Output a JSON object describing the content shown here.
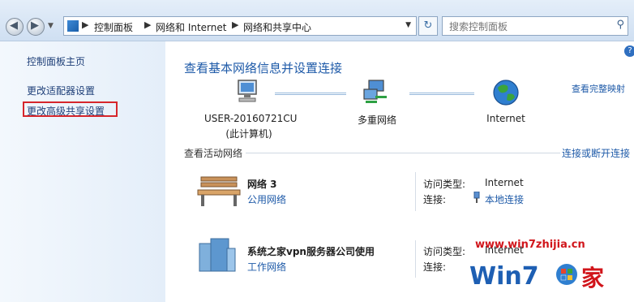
{
  "breadcrumb": [
    "控制面板",
    "网络和 Internet",
    "网络和共享中心"
  ],
  "search": {
    "placeholder": "搜索控制面板"
  },
  "sidebar": {
    "items": [
      "控制面板主页",
      "更改适配器设置",
      "更改高级共享设置"
    ]
  },
  "main": {
    "title": "查看基本网络信息并设置连接",
    "view_full_map": "查看完整映射",
    "map": {
      "computer_name": "USER-20160721CU",
      "computer_sub": "(此计算机)",
      "multi_network": "多重网络",
      "internet": "Internet"
    },
    "active_section": "查看活动网络",
    "connect_link": "连接或断开连接",
    "networks": [
      {
        "name": "网络  3",
        "type": "公用网络",
        "access_label": "访问类型:",
        "access_value": "Internet",
        "conn_label": "连接:",
        "conn_value": "本地连接"
      },
      {
        "name": "系统之家vpn服务器公司使用",
        "type": "工作网络",
        "access_label": "访问类型:",
        "access_value": "Internet",
        "conn_label": "连接:",
        "conn_value": ""
      }
    ]
  },
  "watermark": {
    "url": "www.win7zhijia.cn",
    "logo_text": "Win7",
    "logo_char": "家"
  }
}
